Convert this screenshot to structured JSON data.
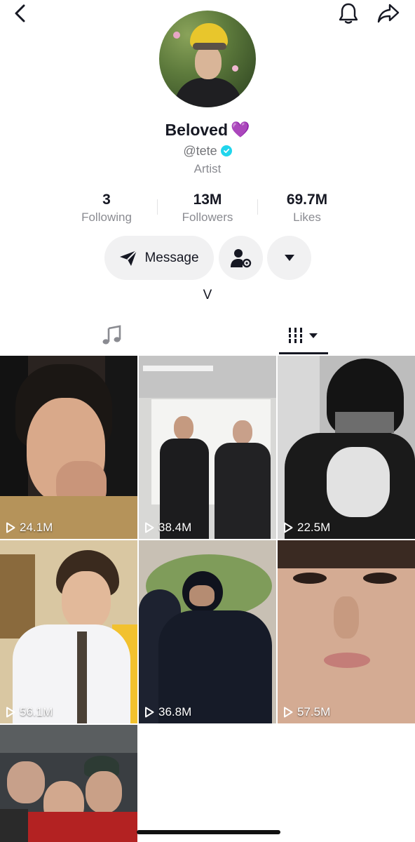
{
  "header": {
    "back_icon": "chevron-left-icon",
    "notification_icon": "bell-icon",
    "share_icon": "share-arrow-icon"
  },
  "profile": {
    "display_name": "Beloved",
    "name_emoji": "💜",
    "handle": "@tete",
    "verified": true,
    "bio": "Artist",
    "bio_expand": "V"
  },
  "stats": [
    {
      "value": "3",
      "label": "Following"
    },
    {
      "value": "13M",
      "label": "Followers"
    },
    {
      "value": "69.7M",
      "label": "Likes"
    }
  ],
  "actions": {
    "message_label": "Message",
    "message_icon": "send-icon",
    "friend_icon": "user-settings-icon",
    "dropdown_icon": "caret-down-icon"
  },
  "tabs": {
    "music_icon": "music-note-icon",
    "videos_icon": "grid-bars-icon"
  },
  "videos": [
    {
      "views": "24.1M"
    },
    {
      "views": "38.4M"
    },
    {
      "views": "22.5M"
    },
    {
      "views": "56.1M"
    },
    {
      "views": "36.8M"
    },
    {
      "views": "57.5M"
    },
    {
      "views": ""
    }
  ],
  "colors": {
    "text_primary": "#161823",
    "text_secondary": "#8a8b91",
    "button_bg": "#f1f1f2",
    "verified": "#20d5ec",
    "heart": "#9b30ff"
  }
}
